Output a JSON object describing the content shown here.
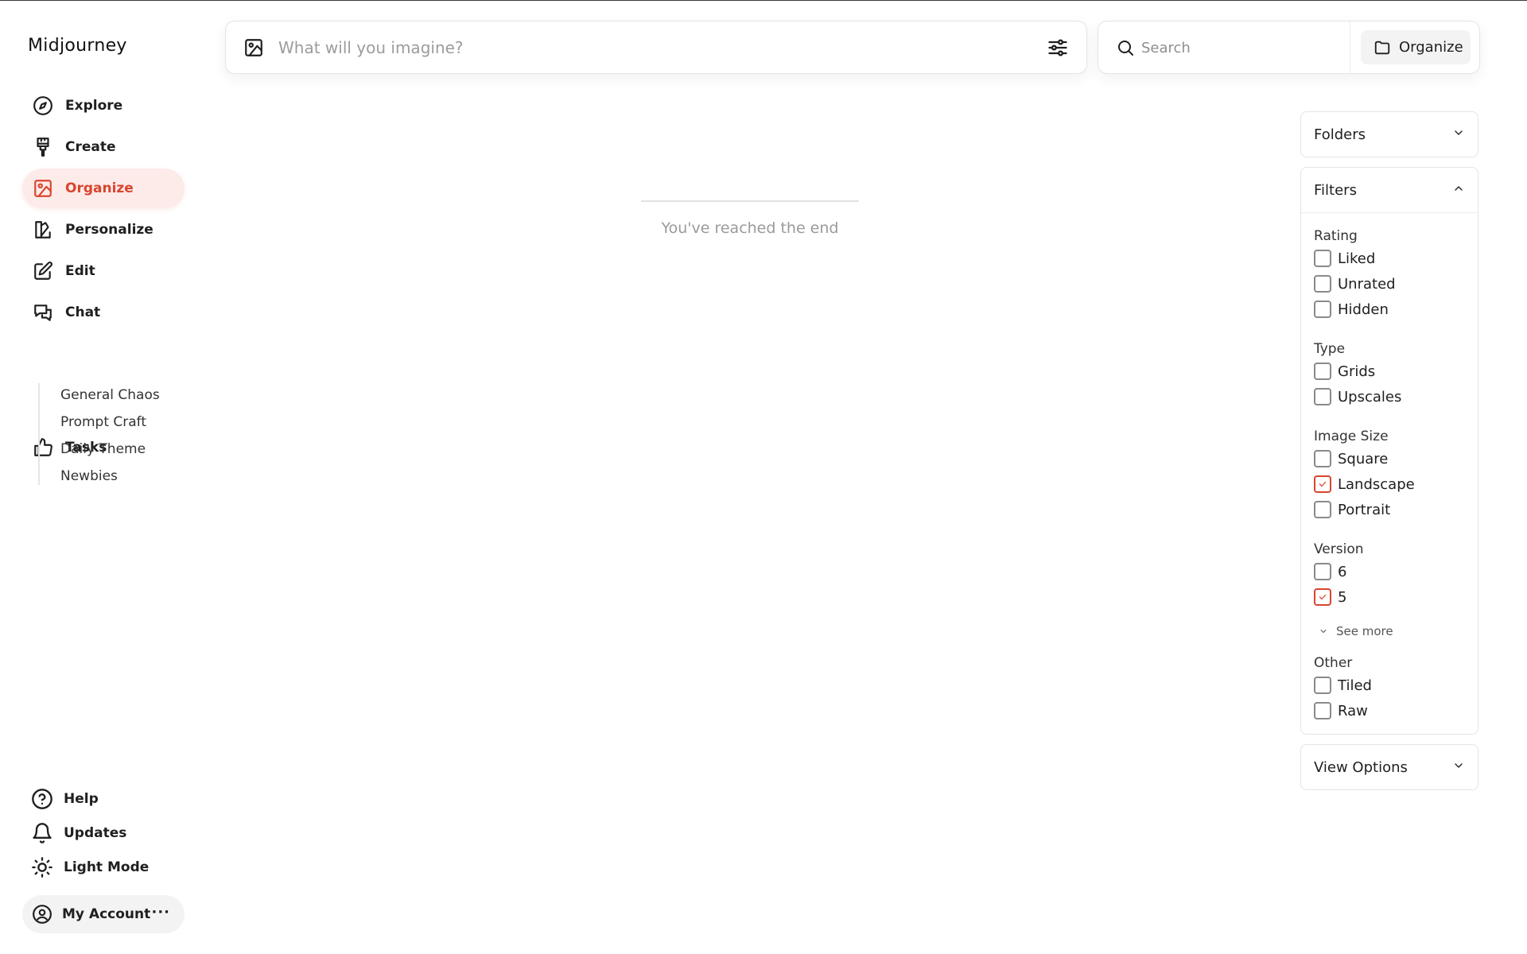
{
  "app": {
    "brand": "Midjourney",
    "accent": "#d9452f"
  },
  "sidebar": {
    "items": [
      {
        "label": "Explore",
        "icon": "compass-icon"
      },
      {
        "label": "Create",
        "icon": "paintbrush-icon"
      },
      {
        "label": "Organize",
        "icon": "image-icon",
        "active": true
      },
      {
        "label": "Personalize",
        "icon": "palette-book-icon"
      },
      {
        "label": "Edit",
        "icon": "pencil-square-icon"
      },
      {
        "label": "Chat",
        "icon": "chat-bubbles-icon"
      },
      {
        "label": "Tasks",
        "icon": "thumbs-up-icon"
      }
    ],
    "chat_rooms": [
      "General Chaos",
      "Prompt Craft",
      "Daily Theme",
      "Newbies"
    ],
    "bottom": [
      {
        "label": "Help",
        "icon": "help-circle-icon"
      },
      {
        "label": "Updates",
        "icon": "bell-icon"
      },
      {
        "label": "Light Mode",
        "icon": "sun-icon"
      }
    ],
    "account": {
      "label": "My Account",
      "more": "···"
    }
  },
  "topbar": {
    "imagine_placeholder": "What will you imagine?",
    "search_placeholder": "Search",
    "organize_button": "Organize"
  },
  "main": {
    "end_message": "You've reached the end"
  },
  "panel": {
    "folders_title": "Folders",
    "filters_title": "Filters",
    "view_options_title": "View Options",
    "groups": [
      {
        "title": "Rating",
        "options": [
          {
            "label": "Liked",
            "checked": false
          },
          {
            "label": "Unrated",
            "checked": false
          },
          {
            "label": "Hidden",
            "checked": false
          }
        ]
      },
      {
        "title": "Type",
        "options": [
          {
            "label": "Grids",
            "checked": false
          },
          {
            "label": "Upscales",
            "checked": false
          }
        ]
      },
      {
        "title": "Image Size",
        "options": [
          {
            "label": "Square",
            "checked": false
          },
          {
            "label": "Landscape",
            "checked": true
          },
          {
            "label": "Portrait",
            "checked": false
          }
        ]
      },
      {
        "title": "Version",
        "options": [
          {
            "label": "6",
            "checked": false
          },
          {
            "label": "5",
            "checked": true
          }
        ],
        "see_more": "See more"
      },
      {
        "title": "Other",
        "options": [
          {
            "label": "Tiled",
            "checked": false
          },
          {
            "label": "Raw",
            "checked": false
          }
        ]
      }
    ]
  }
}
